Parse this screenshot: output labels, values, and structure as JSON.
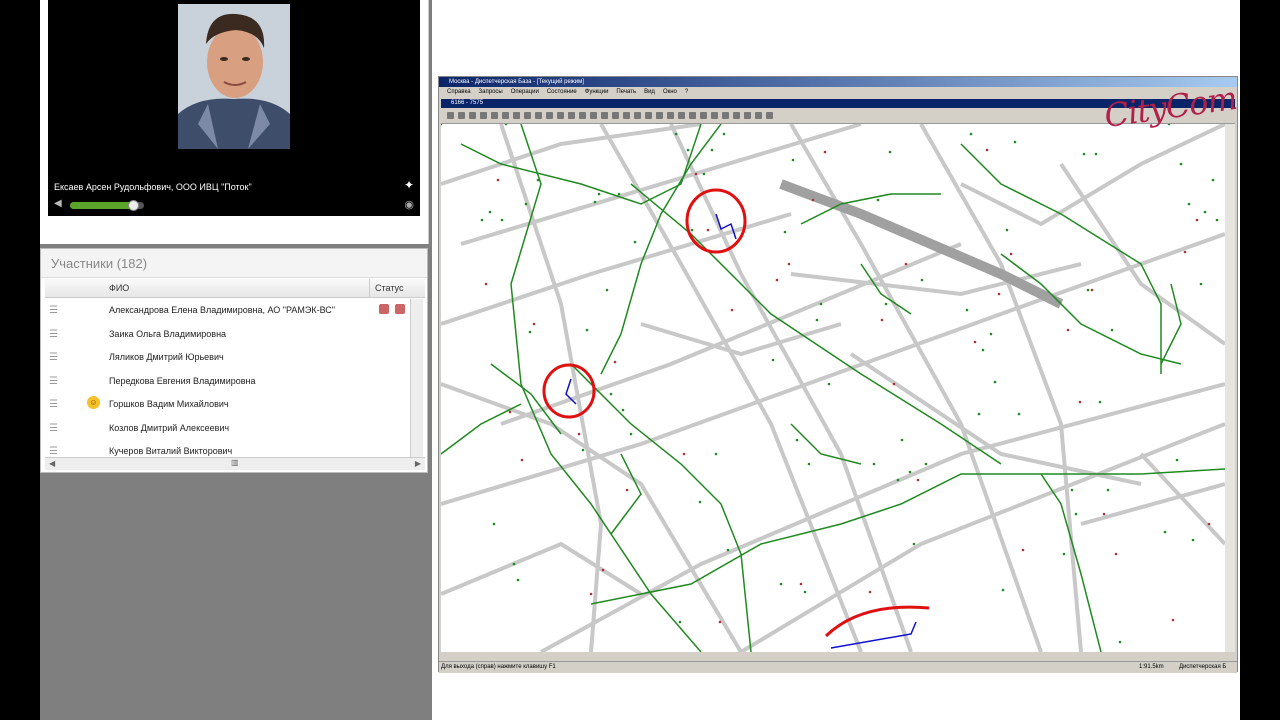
{
  "speaker": {
    "name": "Ексаев Арсен Рудольфович, ООО ИВЦ \"Поток\"",
    "volume_fraction": 0.85
  },
  "participants": {
    "title": "Участники (182)",
    "col_fio": "ФИО",
    "col_status": "Статус",
    "rows": [
      {
        "name": "Александрова Елена Владимировна, АО \"РАМЭК-ВС\"",
        "status": true,
        "emoji": false
      },
      {
        "name": "Заика  Ольга Владимировна",
        "status": false,
        "emoji": false
      },
      {
        "name": "Ляликов  Дмитрий Юрьевич",
        "status": false,
        "emoji": false
      },
      {
        "name": "Передкова  Евгения Владимировна",
        "status": false,
        "emoji": false
      },
      {
        "name": "Горшков  Вадим Михайлович",
        "status": false,
        "emoji": true
      },
      {
        "name": "Козлов  Дмитрий Алексеевич",
        "status": false,
        "emoji": false
      },
      {
        "name": "Кучеров Виталий Викторович",
        "status": false,
        "emoji": false
      }
    ]
  },
  "logo": "CityCom",
  "app": {
    "title": "Москва - Диспетчерская База - [Текущий режим]",
    "menu": [
      "Справка",
      "Запросы",
      "Операции",
      "Состояние",
      "Функции",
      "Печать",
      "Вид",
      "Окно",
      "?"
    ],
    "child_title": "6166 - 7575",
    "status_hint": "Для выхода (справ) нажмите клавишу F1",
    "status_scale": "1:91.5km",
    "status_mode": "Диспетчерская Б"
  },
  "colors": {
    "network": "#1f8a1f",
    "road": "#c8c8c8",
    "mark": "#e01010",
    "highlight": "#1010d0"
  }
}
